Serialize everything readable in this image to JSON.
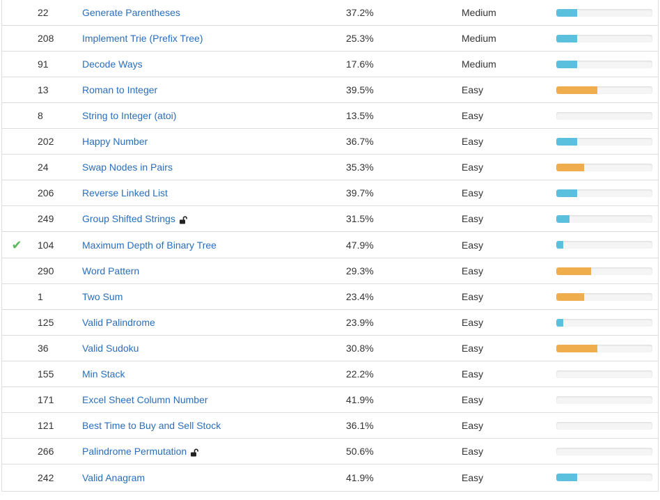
{
  "colors": {
    "link": "#2a6ebb",
    "check": "#5cb85c",
    "bar_blue": "#5bc0de",
    "bar_orange": "#f0ad4e",
    "bar_track": "#f5f5f5"
  },
  "problems": [
    {
      "id": "22",
      "title": "Generate Parentheses",
      "acceptance": "37.2%",
      "difficulty": "Medium",
      "solved": false,
      "locked": false,
      "frequency": 0.22,
      "frequency_color": "blue"
    },
    {
      "id": "208",
      "title": "Implement Trie (Prefix Tree)",
      "acceptance": "25.3%",
      "difficulty": "Medium",
      "solved": false,
      "locked": false,
      "frequency": 0.22,
      "frequency_color": "blue"
    },
    {
      "id": "91",
      "title": "Decode Ways",
      "acceptance": "17.6%",
      "difficulty": "Medium",
      "solved": false,
      "locked": false,
      "frequency": 0.22,
      "frequency_color": "blue"
    },
    {
      "id": "13",
      "title": "Roman to Integer",
      "acceptance": "39.5%",
      "difficulty": "Easy",
      "solved": false,
      "locked": false,
      "frequency": 0.43,
      "frequency_color": "orange"
    },
    {
      "id": "8",
      "title": "String to Integer (atoi)",
      "acceptance": "13.5%",
      "difficulty": "Easy",
      "solved": false,
      "locked": false,
      "frequency": 0,
      "frequency_color": "blue"
    },
    {
      "id": "202",
      "title": "Happy Number",
      "acceptance": "36.7%",
      "difficulty": "Easy",
      "solved": false,
      "locked": false,
      "frequency": 0.22,
      "frequency_color": "blue"
    },
    {
      "id": "24",
      "title": "Swap Nodes in Pairs",
      "acceptance": "35.3%",
      "difficulty": "Easy",
      "solved": false,
      "locked": false,
      "frequency": 0.29,
      "frequency_color": "orange"
    },
    {
      "id": "206",
      "title": "Reverse Linked List",
      "acceptance": "39.7%",
      "difficulty": "Easy",
      "solved": false,
      "locked": false,
      "frequency": 0.22,
      "frequency_color": "blue"
    },
    {
      "id": "249",
      "title": "Group Shifted Strings",
      "acceptance": "31.5%",
      "difficulty": "Easy",
      "solved": false,
      "locked": true,
      "frequency": 0.14,
      "frequency_color": "blue"
    },
    {
      "id": "104",
      "title": "Maximum Depth of Binary Tree",
      "acceptance": "47.9%",
      "difficulty": "Easy",
      "solved": true,
      "locked": false,
      "frequency": 0.07,
      "frequency_color": "blue"
    },
    {
      "id": "290",
      "title": "Word Pattern",
      "acceptance": "29.3%",
      "difficulty": "Easy",
      "solved": false,
      "locked": false,
      "frequency": 0.36,
      "frequency_color": "orange"
    },
    {
      "id": "1",
      "title": "Two Sum",
      "acceptance": "23.4%",
      "difficulty": "Easy",
      "solved": false,
      "locked": false,
      "frequency": 0.29,
      "frequency_color": "orange"
    },
    {
      "id": "125",
      "title": "Valid Palindrome",
      "acceptance": "23.9%",
      "difficulty": "Easy",
      "solved": false,
      "locked": false,
      "frequency": 0.07,
      "frequency_color": "blue"
    },
    {
      "id": "36",
      "title": "Valid Sudoku",
      "acceptance": "30.8%",
      "difficulty": "Easy",
      "solved": false,
      "locked": false,
      "frequency": 0.43,
      "frequency_color": "orange"
    },
    {
      "id": "155",
      "title": "Min Stack",
      "acceptance": "22.2%",
      "difficulty": "Easy",
      "solved": false,
      "locked": false,
      "frequency": 0,
      "frequency_color": "blue"
    },
    {
      "id": "171",
      "title": "Excel Sheet Column Number",
      "acceptance": "41.9%",
      "difficulty": "Easy",
      "solved": false,
      "locked": false,
      "frequency": 0,
      "frequency_color": "blue"
    },
    {
      "id": "121",
      "title": "Best Time to Buy and Sell Stock",
      "acceptance": "36.1%",
      "difficulty": "Easy",
      "solved": false,
      "locked": false,
      "frequency": 0,
      "frequency_color": "blue"
    },
    {
      "id": "266",
      "title": "Palindrome Permutation",
      "acceptance": "50.6%",
      "difficulty": "Easy",
      "solved": false,
      "locked": true,
      "frequency": 0,
      "frequency_color": "blue"
    },
    {
      "id": "242",
      "title": "Valid Anagram",
      "acceptance": "41.9%",
      "difficulty": "Easy",
      "solved": false,
      "locked": false,
      "frequency": 0.22,
      "frequency_color": "blue"
    }
  ]
}
